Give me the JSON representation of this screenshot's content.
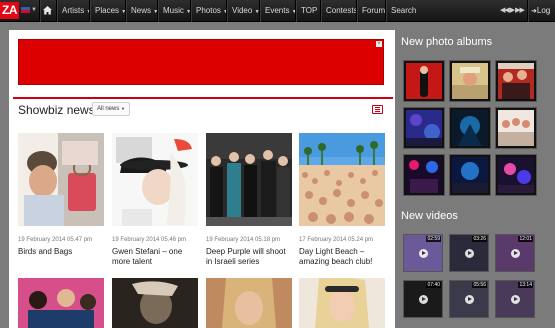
{
  "nav": {
    "logo": "ZA",
    "items": [
      "Artists",
      "Places",
      "News",
      "Music",
      "Photos",
      "Video",
      "Events",
      "TOP",
      "Contests",
      "Forum",
      "Search"
    ],
    "login": "Log"
  },
  "main": {
    "section_title": "Showbiz news",
    "filter_label": "All news",
    "cards": [
      {
        "date": "19 February 2014 05.47 pm",
        "title": "Birds and Bags"
      },
      {
        "date": "19 February 2014 05.46 pm",
        "title": "Gwen Stefani – one more talent"
      },
      {
        "date": "19 February 2014 05.18 pm",
        "title": "Deep Purple will shoot in Israeli series"
      },
      {
        "date": "17 February 2014 05.24 pm",
        "title": "Day Light Beach – amazing beach club!"
      }
    ]
  },
  "sidebar": {
    "albums_title": "New photo albums",
    "videos_title": "New videos",
    "video_durations": [
      "02:59",
      "03:26",
      "12:01",
      "07:40",
      "05:56",
      "13:14"
    ]
  },
  "colors": {
    "accent": "#c90016",
    "nav_bg": "#1e1e1e",
    "page_bg": "#7b7b7b"
  }
}
